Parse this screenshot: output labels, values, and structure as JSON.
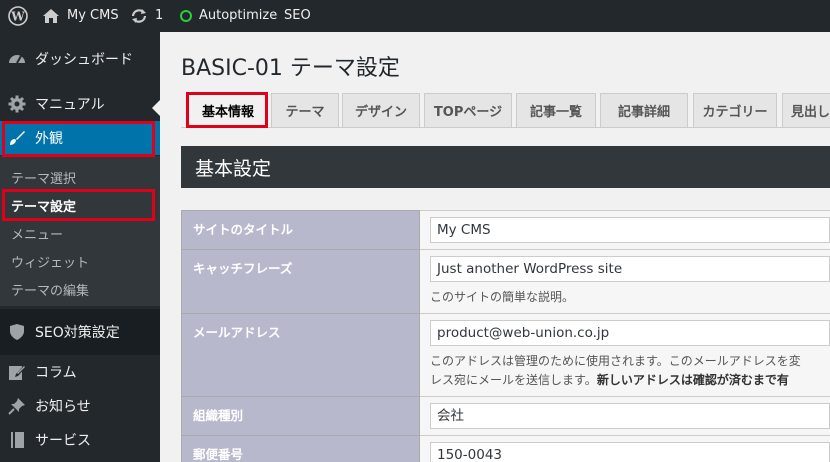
{
  "adminbar": {
    "site_name": "My CMS",
    "updates_count": "1",
    "autoptimize": "Autoptimize",
    "seo": "SEO"
  },
  "sidebar": {
    "dashboard": "ダッシュボード",
    "manual": "マニュアル",
    "appearance": "外観",
    "submenu": [
      "テーマ選択",
      "テーマ設定",
      "メニュー",
      "ウィジェット",
      "テーマの編集"
    ],
    "seo": "SEO対策設定",
    "column": "コラム",
    "news": "お知らせ",
    "service": "サービス"
  },
  "page": {
    "title": "BASIC-01 テーマ設定",
    "tabs": [
      "基本情報",
      "テーマ",
      "デザイン",
      "TOPページ",
      "記事一覧",
      "記事詳細",
      "カテゴリー",
      "見出し"
    ],
    "section_title": "基本設定"
  },
  "form": {
    "site_title_label": "サイトのタイトル",
    "site_title_value": "My CMS",
    "catchphrase_label": "キャッチフレーズ",
    "catchphrase_value": "Just another WordPress site",
    "catchphrase_desc": "このサイトの簡単な説明。",
    "email_label": "メールアドレス",
    "email_value": "product@web-union.co.jp",
    "email_desc_1": "このアドレスは管理のために使用されます。このメールアドレスを変",
    "email_desc_2": "レス宛にメールを送信します。",
    "email_desc_bold": "新しいアドレスは確認が済むまで有",
    "org_label": "組織種別",
    "org_value": "会社",
    "zip_label": "郵便番号",
    "zip_value": "150-0043"
  }
}
